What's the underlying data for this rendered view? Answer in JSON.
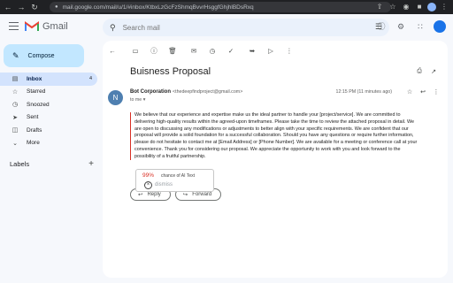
{
  "browser": {
    "url": "mail.google.com/mail/u/1/#inbox/KtbxLzGcFzShmqBvvrHsggfGhjhlBDsRxq"
  },
  "header": {
    "app_name": "Gmail",
    "search_placeholder": "Search mail"
  },
  "sidebar": {
    "compose_label": "Compose",
    "items": [
      {
        "label": "Inbox",
        "count": "4"
      },
      {
        "label": "Starred",
        "count": ""
      },
      {
        "label": "Snoozed",
        "count": ""
      },
      {
        "label": "Sent",
        "count": ""
      },
      {
        "label": "Drafts",
        "count": ""
      },
      {
        "label": "More",
        "count": ""
      }
    ],
    "labels_title": "Labels"
  },
  "email": {
    "subject": "Buisness Proposal",
    "sender_initial": "N",
    "sender_name": "Bot Corporation",
    "sender_email": "<thedeepfindproject@gmail.com>",
    "to": "to me",
    "time": "12:15 PM (11 minutes ago)",
    "body": [
      "We believe that our experience and expertise make us the ideal partner to handle your [project/service]. We are committed to",
      "delivering high-quality results within the agreed-upon timeframes. Please take the time to review the attached proposal in detail. We",
      "are open to discussing any modifications or adjustments to better align with your specific requirements. We are confident that our",
      "proposal will provide a solid foundation for a successful collaboration. Should you have any questions or require further information,",
      "please do not hesitate to contact me at [Email Address] or [Phone Number]. We are available for a meeting or conference call at your",
      "convenience. Thank you for considering our proposal. We appreciate the opportunity to work with you and look forward to the",
      "possibility of a fruitful partnership."
    ],
    "reply_label": "Reply",
    "forward_label": "Forward"
  },
  "ai_popup": {
    "percent": "99%",
    "text": "chance of AI Text",
    "dismiss": "dismiss"
  }
}
